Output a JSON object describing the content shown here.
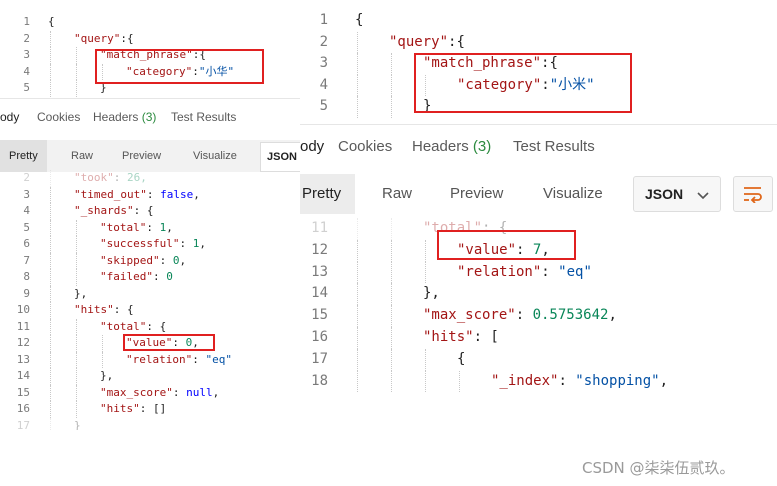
{
  "left": {
    "request": {
      "line_numbers": [
        "1",
        "2",
        "3",
        "4",
        "5"
      ],
      "lines": [
        {
          "t": "{",
          "indent": 0
        },
        {
          "k": "\"query\"",
          "p": ":{",
          "indent": 1
        },
        {
          "k": "\"match_phrase\"",
          "p": ":{",
          "indent": 2
        },
        {
          "k": "\"category\"",
          "p": ":",
          "s": "\"小华\"",
          "indent": 3
        },
        {
          "t": "}",
          "indent": 2
        }
      ]
    },
    "tabs": {
      "body": "ody",
      "cookies": "Cookies",
      "headers": "Headers",
      "headers_count": "(3)",
      "test_results": "Test Results"
    },
    "modes": {
      "pretty": "Pretty",
      "raw": "Raw",
      "preview": "Preview",
      "visualize": "Visualize",
      "format": "JSON"
    },
    "response": {
      "line_numbers": [
        "2",
        "3",
        "4",
        "5",
        "6",
        "7",
        "8",
        "9",
        "10",
        "11",
        "12",
        "13",
        "14",
        "15",
        "16",
        "17"
      ],
      "lines": [
        {
          "k": "\"took\"",
          "p": ": ",
          "n": "26,",
          "indent": 1,
          "faded": true
        },
        {
          "k": "\"timed_out\"",
          "p": ": ",
          "w": "false",
          "e": ",",
          "indent": 1
        },
        {
          "k": "\"_shards\"",
          "p": ": {",
          "indent": 1
        },
        {
          "k": "\"total\"",
          "p": ": ",
          "n": "1",
          "e": ",",
          "indent": 2
        },
        {
          "k": "\"successful\"",
          "p": ": ",
          "n": "1",
          "e": ",",
          "indent": 2
        },
        {
          "k": "\"skipped\"",
          "p": ": ",
          "n": "0",
          "e": ",",
          "indent": 2
        },
        {
          "k": "\"failed\"",
          "p": ": ",
          "n": "0",
          "indent": 2
        },
        {
          "t": "},",
          "indent": 1
        },
        {
          "k": "\"hits\"",
          "p": ": {",
          "indent": 1
        },
        {
          "k": "\"total\"",
          "p": ": {",
          "indent": 2
        },
        {
          "k": "\"value\"",
          "p": ": ",
          "n": "0",
          "e": ",",
          "indent": 3
        },
        {
          "k": "\"relation\"",
          "p": ": ",
          "s": "\"eq\"",
          "indent": 3
        },
        {
          "t": "},",
          "indent": 2
        },
        {
          "k": "\"max_score\"",
          "p": ": ",
          "w": "null",
          "e": ",",
          "indent": 2
        },
        {
          "k": "\"hits\"",
          "p": ": ",
          "t2": "[]",
          "indent": 2
        },
        {
          "t": "}",
          "indent": 1,
          "faded": true
        }
      ]
    }
  },
  "right": {
    "request": {
      "line_numbers": [
        "1",
        "2",
        "3",
        "4",
        "5"
      ],
      "lines": [
        {
          "t": "{",
          "indent": 0
        },
        {
          "k": "\"query\"",
          "p": ":{",
          "indent": 1
        },
        {
          "k": "\"match_phrase\"",
          "p": ":{",
          "indent": 2
        },
        {
          "k": "\"category\"",
          "p": ":",
          "s": "\"小米\"",
          "indent": 3
        },
        {
          "t": "}",
          "indent": 2
        }
      ]
    },
    "tabs": {
      "body": "ody",
      "cookies": "Cookies",
      "headers": "Headers",
      "headers_count": "(3)",
      "test_results": "Test Results"
    },
    "modes": {
      "pretty": "Pretty",
      "raw": "Raw",
      "preview": "Preview",
      "visualize": "Visualize",
      "format": "JSON"
    },
    "response": {
      "line_numbers": [
        "11",
        "12",
        "13",
        "14",
        "15",
        "16",
        "17",
        "18"
      ],
      "lines": [
        {
          "k": "\"total\"",
          "p": ": {",
          "indent": 2,
          "faded": true
        },
        {
          "k": "\"value\"",
          "p": ": ",
          "n": "7",
          "e": ",",
          "indent": 3
        },
        {
          "k": "\"relation\"",
          "p": ": ",
          "s": "\"eq\"",
          "indent": 3
        },
        {
          "t": "},",
          "indent": 2
        },
        {
          "k": "\"max_score\"",
          "p": ": ",
          "n": "0.5753642",
          "e": ",",
          "indent": 2
        },
        {
          "k": "\"hits\"",
          "p": ": [",
          "indent": 2
        },
        {
          "t": "{",
          "indent": 3
        },
        {
          "k": "\"_index\"",
          "p": ": ",
          "s": "\"shopping\"",
          "e": ",",
          "indent": 4
        }
      ]
    }
  },
  "watermark": "CSDN @柒柒伍贰玖。",
  "colors": {
    "highlight_box": "#e02020",
    "key": "#a31515",
    "string": "#0451a5",
    "number": "#098658",
    "keyword": "#0000ff"
  },
  "icons": {
    "dropdown": "chevron-down-icon",
    "wrap": "wrap-lines-icon"
  }
}
